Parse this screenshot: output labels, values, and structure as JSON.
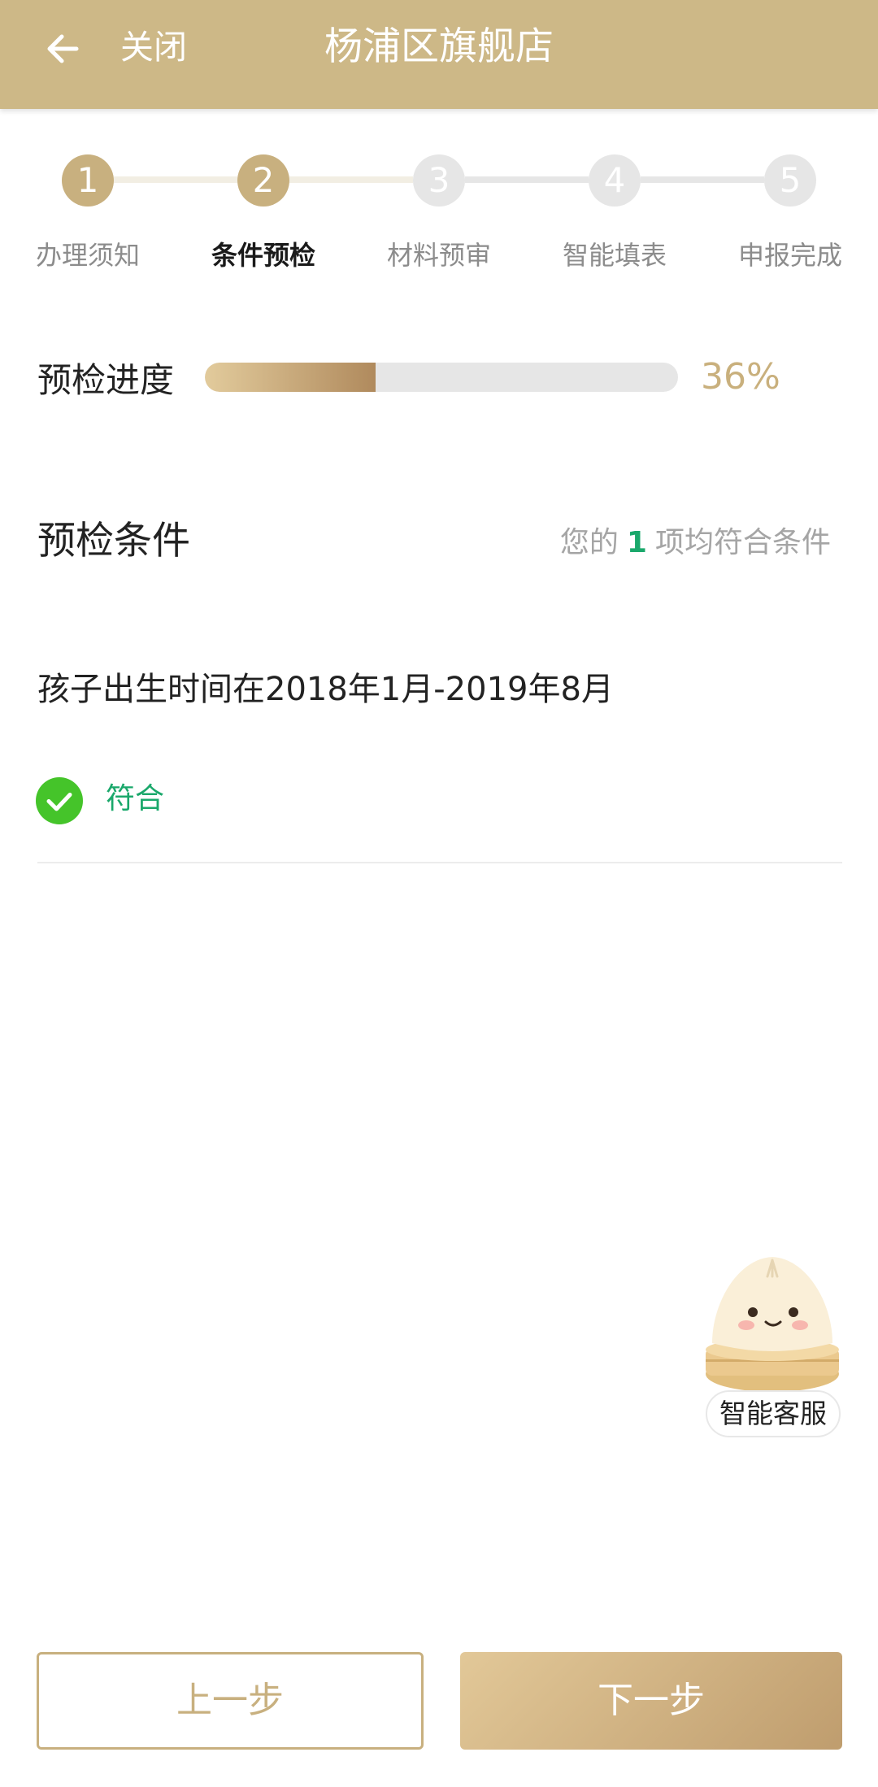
{
  "header": {
    "close_label": "关闭",
    "title": "杨浦区旗舰店"
  },
  "stepper": {
    "current_index": 1,
    "steps": [
      {
        "number": "1",
        "label": "办理须知"
      },
      {
        "number": "2",
        "label": "条件预检"
      },
      {
        "number": "3",
        "label": "材料预审"
      },
      {
        "number": "4",
        "label": "智能填表"
      },
      {
        "number": "5",
        "label": "申报完成"
      }
    ]
  },
  "progress": {
    "label": "预检进度",
    "percent_text": "36%",
    "value": 0.36
  },
  "conditions": {
    "title": "预检条件",
    "summary_prefix": "您的",
    "summary_count": "1",
    "summary_suffix": "项均符合条件",
    "items": [
      {
        "text": "孩子出生时间在2018年1月-2019年8月",
        "status": "符合"
      }
    ]
  },
  "assistant": {
    "label": "智能客服"
  },
  "footer": {
    "prev_label": "上一步",
    "next_label": "下一步"
  },
  "colors": {
    "header": "#cdb887",
    "accent": "#c8b07f",
    "success": "#1aa86b",
    "check": "#45c42a"
  }
}
